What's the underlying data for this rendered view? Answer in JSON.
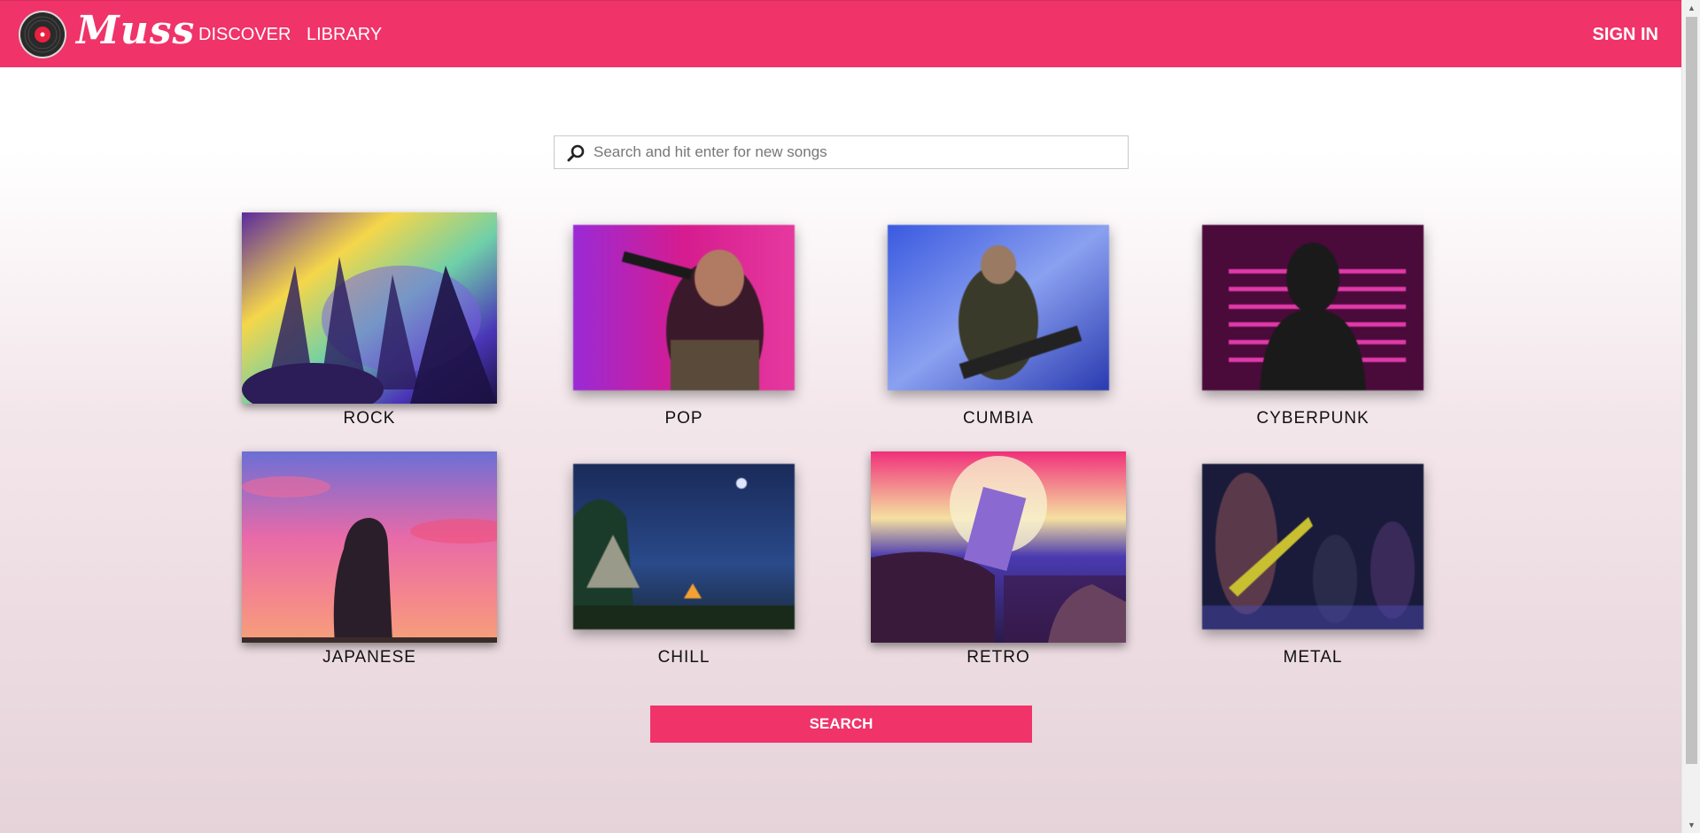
{
  "nav": {
    "brand": "Muss",
    "discover": "DISCOVER",
    "library": "LIBRARY",
    "sign_in": "SIGN IN"
  },
  "search": {
    "placeholder": "Search and hit enter for new songs"
  },
  "genres": [
    {
      "label": "ROCK",
      "selected": true
    },
    {
      "label": "POP",
      "selected": false
    },
    {
      "label": "CUMBIA",
      "selected": false
    },
    {
      "label": "CYBERPUNK",
      "selected": false
    },
    {
      "label": "JAPANESE",
      "selected": true
    },
    {
      "label": "CHILL",
      "selected": false
    },
    {
      "label": "RETRO",
      "selected": true
    },
    {
      "label": "METAL",
      "selected": false
    }
  ],
  "search_button": "SEARCH",
  "colors": {
    "accent": "#f03369"
  }
}
